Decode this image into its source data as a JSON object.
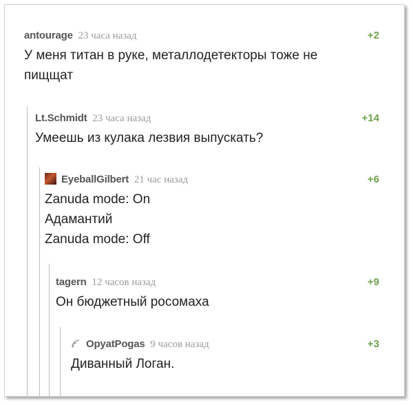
{
  "comments": [
    {
      "author": "antourage",
      "time": "23 часа назад",
      "rating": "+2",
      "text": "У меня титан в руке, металлодетекторы тоже не\nпищщат"
    },
    {
      "author": "Lt.Schmidt",
      "time": "23 часа назад",
      "rating": "+14",
      "text": "Умеешь из кулака лезвия выпускать?"
    },
    {
      "author": "EyeballGilbert",
      "time": "21 час назад",
      "rating": "+6",
      "text": "Zanuda mode: On\nАдамантий\nZanuda mode: Off"
    },
    {
      "author": "tagern",
      "time": "12 часов назад",
      "rating": "+9",
      "text": "Он бюджетный росомаха"
    },
    {
      "author": "OpyatPogas",
      "time": "9 часов назад",
      "rating": "+3",
      "text": "Диванный Логан."
    }
  ],
  "colors": {
    "rating": "#6fa24b",
    "author": "#555555",
    "time": "#9a9a9a",
    "thread_line": "#bdbdbd"
  },
  "icons": {
    "eyeballgilbert_avatar": "user-avatar-image",
    "opyatpogas_avatar": "wifi-signal-icon"
  }
}
